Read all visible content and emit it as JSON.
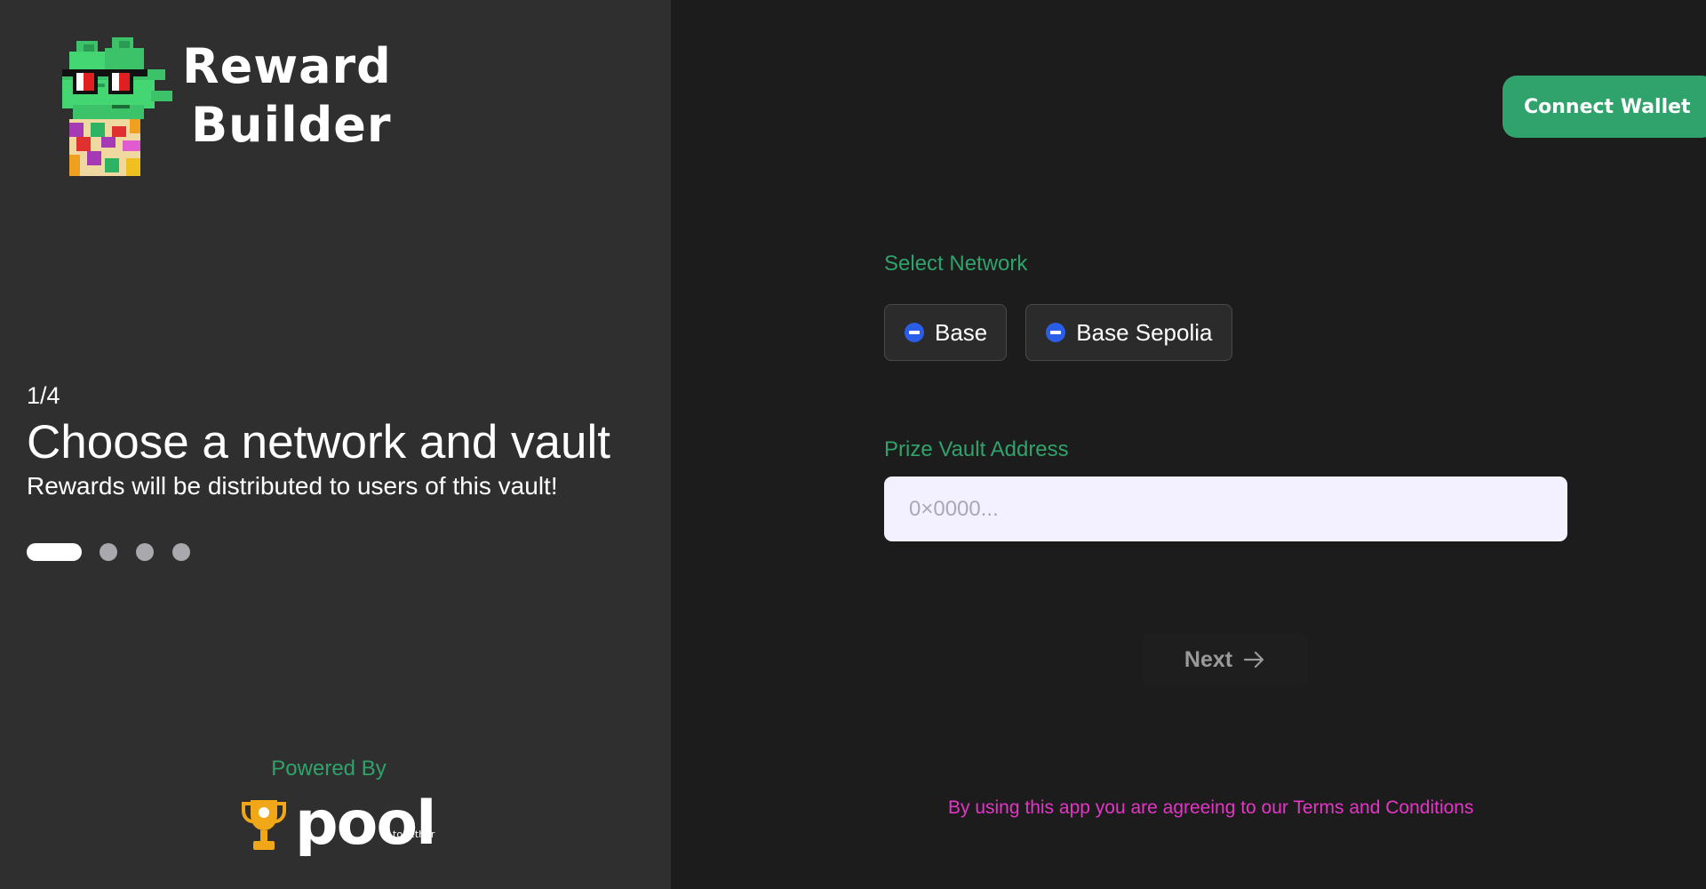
{
  "brand": {
    "title_line1": "Reward",
    "title_line2": "Builder",
    "logo_icon": "clover-mascot-icon"
  },
  "header": {
    "connect_wallet_label": "Connect Wallet"
  },
  "steps": {
    "counter": "1/4",
    "title": "Choose a network and vault",
    "subtitle": "Rewards will be distributed to users of this vault!",
    "current": 1,
    "total": 4
  },
  "footer_left": {
    "powered_by": "Powered By",
    "pool_word": "pool",
    "pool_sub": "together",
    "trophy_icon": "trophy-icon"
  },
  "form": {
    "network_label": "Select Network",
    "networks": [
      {
        "label": "Base",
        "icon": "base-network-icon"
      },
      {
        "label": "Base Sepolia",
        "icon": "base-network-icon"
      }
    ],
    "vault_label": "Prize Vault Address",
    "vault_placeholder": "0×0000...",
    "vault_value": "",
    "next_label": "Next",
    "next_icon": "arrow-right-icon"
  },
  "terms": {
    "prefix": "By using this app you are agreeing to our ",
    "link": "Terms and Conditions"
  },
  "colors": {
    "left_panel_bg": "#2f2f2f",
    "right_panel_bg": "#1c1c1c",
    "accent_green": "#2fa36b",
    "terms_pink": "#e535c8",
    "input_bg": "#f3f0ff"
  }
}
